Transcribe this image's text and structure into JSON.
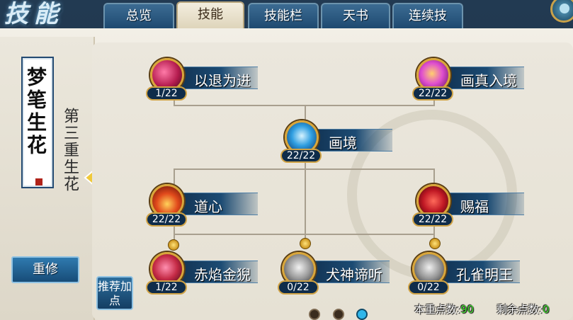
{
  "window": {
    "title": "技能",
    "tabs": [
      {
        "label": "总览",
        "active": false
      },
      {
        "label": "技能",
        "active": true
      },
      {
        "label": "技能栏",
        "active": false
      },
      {
        "label": "天书",
        "active": false
      },
      {
        "label": "连续技",
        "active": false
      }
    ]
  },
  "sidebar": {
    "card_title": "梦笔生花",
    "tier_label": "第三重生花",
    "reset_label": "重修"
  },
  "recommend_label": "推荐加点",
  "skills": [
    {
      "name": "以退为进",
      "count": "1/22",
      "icon": "crimson-dragon-icon",
      "color": "#b51c4f"
    },
    {
      "name": "画真入境",
      "count": "22/22",
      "icon": "pink-flame-icon",
      "color": "#c22fa8"
    },
    {
      "name": "画境",
      "count": "22/22",
      "icon": "blue-wave-icon",
      "color": "#1e7fc6"
    },
    {
      "name": "道心",
      "count": "22/22",
      "icon": "red-flame-icon",
      "color": "#d1371c"
    },
    {
      "name": "赐福",
      "count": "22/22",
      "icon": "red-shield-icon",
      "color": "#b4131f"
    },
    {
      "name": "赤焰金猊",
      "count": "1/22",
      "icon": "fire-lion-icon",
      "color": "#c42a45"
    },
    {
      "name": "犬神谛听",
      "count": "0/22",
      "icon": "gray-beast-icon",
      "color": "#8a8a8a"
    },
    {
      "name": "孔雀明王",
      "count": "0/22",
      "icon": "gray-peacock-icon",
      "color": "#8a8a8a"
    }
  ],
  "footer": {
    "points_spent_label": "本重点数:",
    "points_spent": "90",
    "points_left_label": "剩余点数:",
    "points_left": "0"
  },
  "pagination": {
    "pages": 3,
    "current": 3
  }
}
